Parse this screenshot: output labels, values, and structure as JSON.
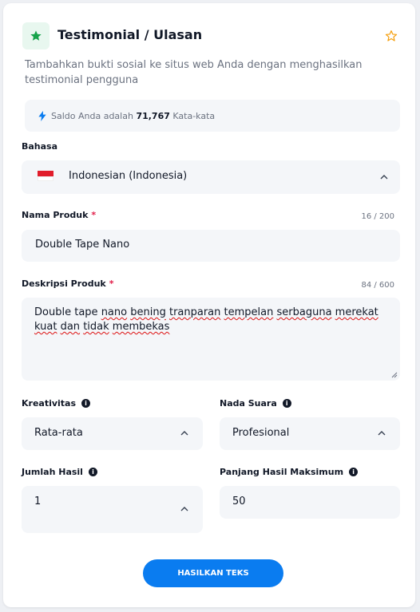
{
  "header": {
    "title": "Testimonial / Ulasan",
    "description": "Tambahkan bukti sosial ke situs web Anda dengan menghasilkan testimonial pengguna"
  },
  "balance": {
    "prefix": "Saldo Anda adalah",
    "amount": "71,767",
    "suffix": "Kata-kata"
  },
  "language": {
    "label": "Bahasa",
    "value": "Indonesian (Indonesia)"
  },
  "product_name": {
    "label": "Nama Produk",
    "required_mark": "*",
    "counter": "16 / 200",
    "value": "Double Tape Nano"
  },
  "product_desc": {
    "label": "Deskripsi Produk",
    "required_mark": "*",
    "counter": "84 / 600",
    "words": [
      "Double",
      "tape",
      "nano",
      "bening",
      "tranparan",
      "tempelan",
      "serbaguna",
      "merekat",
      "kuat",
      "dan",
      "tidak",
      "membekas"
    ]
  },
  "creativity": {
    "label": "Kreativitas",
    "value": "Rata-rata"
  },
  "tone": {
    "label": "Nada Suara",
    "value": "Profesional"
  },
  "result_count": {
    "label": "Jumlah Hasil",
    "value": "1"
  },
  "max_length": {
    "label": "Panjang Hasil Maksimum",
    "value": "50"
  },
  "generate_button": {
    "label": "HASILKAN TEKS"
  },
  "icons": {
    "header": "star-icon",
    "favorite": "star-outline-icon",
    "balance": "lightning-icon",
    "flag": "indonesia-flag-icon",
    "info": "info-icon",
    "chevron": "chevron-up-icon"
  },
  "colors": {
    "accent": "#0a7cf0",
    "header_icon": "#16a34a",
    "favorite_icon": "#f59e0b",
    "required": "#e11d48"
  }
}
